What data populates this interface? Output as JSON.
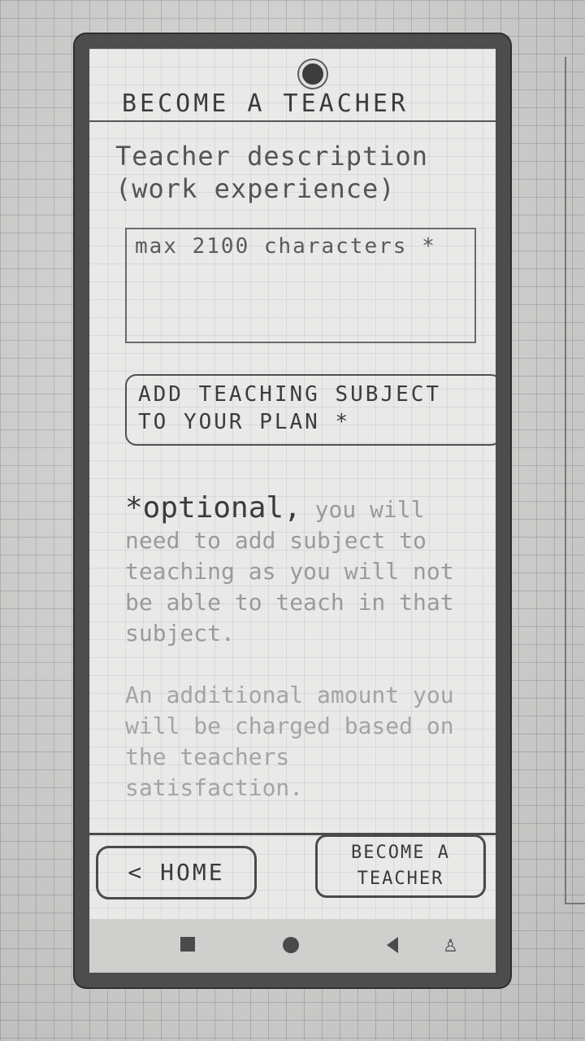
{
  "header": {
    "title": "BECOME A TEACHER"
  },
  "form": {
    "description_label": "Teacher description (work experience)",
    "description_placeholder": "max 2100 characters *",
    "subject_button_label": "ADD TEACHING SUBJECT\nTO YOUR PLAN *",
    "note_marker": "*optional,",
    "note_rest": "you will need to add subject to teaching as you will not be able to teach in that subject.",
    "note_second": "An additional amount you will be charged based on the teachers satisfaction."
  },
  "footer": {
    "home_label": "< HOME",
    "become_label": "BECOME A\nTEACHER"
  },
  "nav": {
    "recents_icon": "square-icon",
    "home_icon": "circle-icon",
    "back_icon": "triangle-back-icon",
    "accessibility_icon": "person-icon",
    "accessibility_glyph": "♙"
  }
}
